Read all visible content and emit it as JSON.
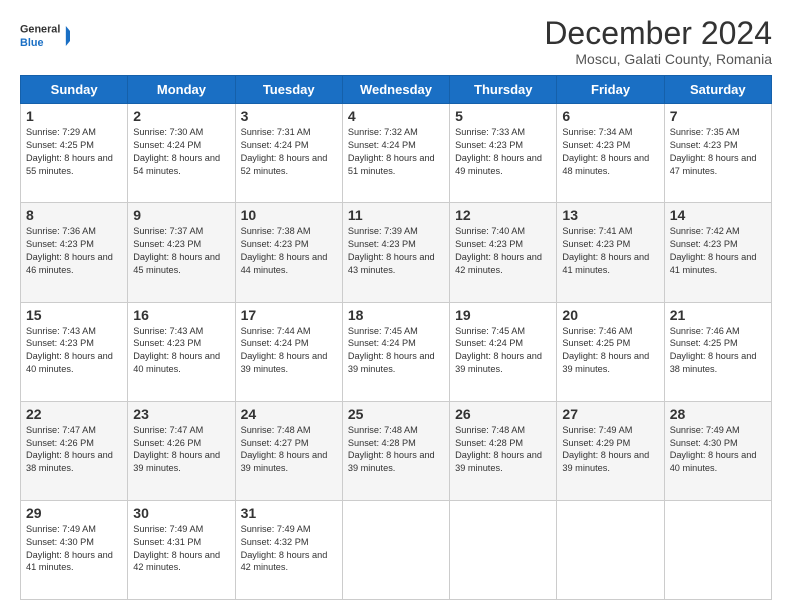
{
  "logo": {
    "line1": "General",
    "line2": "Blue"
  },
  "title": "December 2024",
  "subtitle": "Moscu, Galati County, Romania",
  "days_of_week": [
    "Sunday",
    "Monday",
    "Tuesday",
    "Wednesday",
    "Thursday",
    "Friday",
    "Saturday"
  ],
  "weeks": [
    [
      {
        "day": "1",
        "sunrise": "Sunrise: 7:29 AM",
        "sunset": "Sunset: 4:25 PM",
        "daylight": "Daylight: 8 hours and 55 minutes."
      },
      {
        "day": "2",
        "sunrise": "Sunrise: 7:30 AM",
        "sunset": "Sunset: 4:24 PM",
        "daylight": "Daylight: 8 hours and 54 minutes."
      },
      {
        "day": "3",
        "sunrise": "Sunrise: 7:31 AM",
        "sunset": "Sunset: 4:24 PM",
        "daylight": "Daylight: 8 hours and 52 minutes."
      },
      {
        "day": "4",
        "sunrise": "Sunrise: 7:32 AM",
        "sunset": "Sunset: 4:24 PM",
        "daylight": "Daylight: 8 hours and 51 minutes."
      },
      {
        "day": "5",
        "sunrise": "Sunrise: 7:33 AM",
        "sunset": "Sunset: 4:23 PM",
        "daylight": "Daylight: 8 hours and 49 minutes."
      },
      {
        "day": "6",
        "sunrise": "Sunrise: 7:34 AM",
        "sunset": "Sunset: 4:23 PM",
        "daylight": "Daylight: 8 hours and 48 minutes."
      },
      {
        "day": "7",
        "sunrise": "Sunrise: 7:35 AM",
        "sunset": "Sunset: 4:23 PM",
        "daylight": "Daylight: 8 hours and 47 minutes."
      }
    ],
    [
      {
        "day": "8",
        "sunrise": "Sunrise: 7:36 AM",
        "sunset": "Sunset: 4:23 PM",
        "daylight": "Daylight: 8 hours and 46 minutes."
      },
      {
        "day": "9",
        "sunrise": "Sunrise: 7:37 AM",
        "sunset": "Sunset: 4:23 PM",
        "daylight": "Daylight: 8 hours and 45 minutes."
      },
      {
        "day": "10",
        "sunrise": "Sunrise: 7:38 AM",
        "sunset": "Sunset: 4:23 PM",
        "daylight": "Daylight: 8 hours and 44 minutes."
      },
      {
        "day": "11",
        "sunrise": "Sunrise: 7:39 AM",
        "sunset": "Sunset: 4:23 PM",
        "daylight": "Daylight: 8 hours and 43 minutes."
      },
      {
        "day": "12",
        "sunrise": "Sunrise: 7:40 AM",
        "sunset": "Sunset: 4:23 PM",
        "daylight": "Daylight: 8 hours and 42 minutes."
      },
      {
        "day": "13",
        "sunrise": "Sunrise: 7:41 AM",
        "sunset": "Sunset: 4:23 PM",
        "daylight": "Daylight: 8 hours and 41 minutes."
      },
      {
        "day": "14",
        "sunrise": "Sunrise: 7:42 AM",
        "sunset": "Sunset: 4:23 PM",
        "daylight": "Daylight: 8 hours and 41 minutes."
      }
    ],
    [
      {
        "day": "15",
        "sunrise": "Sunrise: 7:43 AM",
        "sunset": "Sunset: 4:23 PM",
        "daylight": "Daylight: 8 hours and 40 minutes."
      },
      {
        "day": "16",
        "sunrise": "Sunrise: 7:43 AM",
        "sunset": "Sunset: 4:23 PM",
        "daylight": "Daylight: 8 hours and 40 minutes."
      },
      {
        "day": "17",
        "sunrise": "Sunrise: 7:44 AM",
        "sunset": "Sunset: 4:24 PM",
        "daylight": "Daylight: 8 hours and 39 minutes."
      },
      {
        "day": "18",
        "sunrise": "Sunrise: 7:45 AM",
        "sunset": "Sunset: 4:24 PM",
        "daylight": "Daylight: 8 hours and 39 minutes."
      },
      {
        "day": "19",
        "sunrise": "Sunrise: 7:45 AM",
        "sunset": "Sunset: 4:24 PM",
        "daylight": "Daylight: 8 hours and 39 minutes."
      },
      {
        "day": "20",
        "sunrise": "Sunrise: 7:46 AM",
        "sunset": "Sunset: 4:25 PM",
        "daylight": "Daylight: 8 hours and 39 minutes."
      },
      {
        "day": "21",
        "sunrise": "Sunrise: 7:46 AM",
        "sunset": "Sunset: 4:25 PM",
        "daylight": "Daylight: 8 hours and 38 minutes."
      }
    ],
    [
      {
        "day": "22",
        "sunrise": "Sunrise: 7:47 AM",
        "sunset": "Sunset: 4:26 PM",
        "daylight": "Daylight: 8 hours and 38 minutes."
      },
      {
        "day": "23",
        "sunrise": "Sunrise: 7:47 AM",
        "sunset": "Sunset: 4:26 PM",
        "daylight": "Daylight: 8 hours and 39 minutes."
      },
      {
        "day": "24",
        "sunrise": "Sunrise: 7:48 AM",
        "sunset": "Sunset: 4:27 PM",
        "daylight": "Daylight: 8 hours and 39 minutes."
      },
      {
        "day": "25",
        "sunrise": "Sunrise: 7:48 AM",
        "sunset": "Sunset: 4:28 PM",
        "daylight": "Daylight: 8 hours and 39 minutes."
      },
      {
        "day": "26",
        "sunrise": "Sunrise: 7:48 AM",
        "sunset": "Sunset: 4:28 PM",
        "daylight": "Daylight: 8 hours and 39 minutes."
      },
      {
        "day": "27",
        "sunrise": "Sunrise: 7:49 AM",
        "sunset": "Sunset: 4:29 PM",
        "daylight": "Daylight: 8 hours and 39 minutes."
      },
      {
        "day": "28",
        "sunrise": "Sunrise: 7:49 AM",
        "sunset": "Sunset: 4:30 PM",
        "daylight": "Daylight: 8 hours and 40 minutes."
      }
    ],
    [
      {
        "day": "29",
        "sunrise": "Sunrise: 7:49 AM",
        "sunset": "Sunset: 4:30 PM",
        "daylight": "Daylight: 8 hours and 41 minutes."
      },
      {
        "day": "30",
        "sunrise": "Sunrise: 7:49 AM",
        "sunset": "Sunset: 4:31 PM",
        "daylight": "Daylight: 8 hours and 42 minutes."
      },
      {
        "day": "31",
        "sunrise": "Sunrise: 7:49 AM",
        "sunset": "Sunset: 4:32 PM",
        "daylight": "Daylight: 8 hours and 42 minutes."
      },
      null,
      null,
      null,
      null
    ]
  ]
}
